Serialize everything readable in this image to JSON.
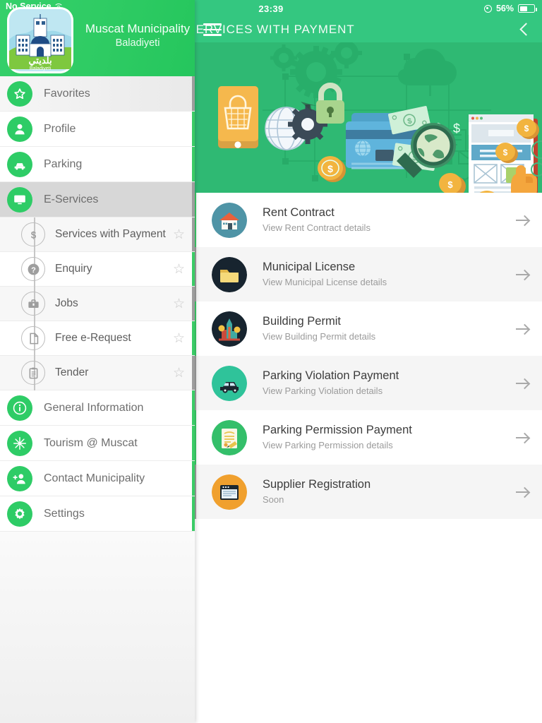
{
  "status_bar": {
    "carrier": "No Service",
    "wifi_icon": "wifi-icon",
    "time": "23:39",
    "location_icon": "location-arrow-icon",
    "battery_percent": "56%",
    "battery_icon": "battery-icon"
  },
  "app_bar": {
    "menu_icon": "hamburger-menu-icon",
    "title": "SERVICES WITH PAYMENT",
    "back_icon": "chevron-left-icon"
  },
  "drawer": {
    "logo_icon": "muscat-municipality-logo",
    "logo_arabic": "بلديتي",
    "logo_caption": "Baladiyeti",
    "brand_line1": "Muscat Municipality",
    "brand_line2": "Baladiyeti",
    "items": [
      {
        "label": "Favorites",
        "icon": "star-icon",
        "selected": false,
        "shade": "a"
      },
      {
        "label": "Profile",
        "icon": "person-icon",
        "selected": false,
        "shade": "w"
      },
      {
        "label": "Parking",
        "icon": "car-icon",
        "selected": false,
        "shade": "w"
      },
      {
        "label": "E-Services",
        "icon": "monitor-icon",
        "selected": true,
        "shade": "sel"
      },
      {
        "label": "General Information",
        "icon": "info-icon",
        "selected": false,
        "shade": "w"
      },
      {
        "label": "Tourism @ Muscat",
        "icon": "tourism-icon",
        "selected": false,
        "shade": "w"
      },
      {
        "label": "Contact Municipality",
        "icon": "person-add-icon",
        "selected": false,
        "shade": "w"
      },
      {
        "label": "Settings",
        "icon": "gear-icon",
        "selected": false,
        "shade": "w"
      }
    ],
    "sub_items": [
      {
        "label": "Services with Payment",
        "icon": "dollar-icon",
        "star": "☆",
        "shade": "a"
      },
      {
        "label": "Enquiry",
        "icon": "question-icon",
        "star": "☆",
        "shade": "w"
      },
      {
        "label": "Jobs",
        "icon": "briefcase-icon",
        "star": "☆",
        "shade": "a"
      },
      {
        "label": "Free e-Request",
        "icon": "document-icon",
        "star": "☆",
        "shade": "w"
      },
      {
        "label": "Tender",
        "icon": "clipboard-icon",
        "star": "☆",
        "shade": "a"
      }
    ]
  },
  "hero": {
    "name": "e-payment-illustration",
    "background_color": "#2FB973"
  },
  "services": [
    {
      "title": "Rent Contract",
      "subtitle": "View Rent Contract details",
      "icon": "house-icon",
      "icon_bg": "#4F94A6",
      "arrow": "arrow-right-icon",
      "shade": "plain"
    },
    {
      "title": "Municipal License",
      "subtitle": "View Municipal License details",
      "icon": "folder-icon",
      "icon_bg": "#1E2B38",
      "arrow": "arrow-right-icon",
      "shade": "alt"
    },
    {
      "title": "Building Permit",
      "subtitle": "View Building Permit details",
      "icon": "city-icon",
      "icon_bg": "#1E2B38",
      "arrow": "arrow-right-icon",
      "shade": "plain"
    },
    {
      "title": "Parking Violation Payment",
      "subtitle": "View Parking Violation details",
      "icon": "car-icon",
      "icon_bg": "#2FC39A",
      "arrow": "arrow-right-icon",
      "shade": "alt"
    },
    {
      "title": "Parking Permission Payment",
      "subtitle": "View Parking Permission details",
      "icon": "certificate-icon",
      "icon_bg": "#34BF6A",
      "arrow": "arrow-right-icon",
      "shade": "plain"
    },
    {
      "title": "Supplier Registration",
      "subtitle": "Soon",
      "icon": "browser-icon",
      "icon_bg": "#F0A02E",
      "arrow": "arrow-right-icon",
      "shade": "alt"
    }
  ],
  "colors": {
    "brand_green": "#2ECC66",
    "header_green": "#34C780",
    "hero_green": "#2FB973",
    "accent_edge": "#3ACB66",
    "muted_edge": "#9D9D9D"
  }
}
